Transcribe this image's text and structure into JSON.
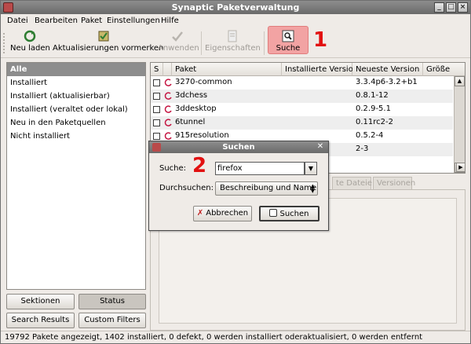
{
  "window": {
    "title": "Synaptic Paketverwaltung",
    "controls": [
      "_",
      "□",
      "×"
    ]
  },
  "menu": [
    "Datei",
    "Bearbeiten",
    "Paket",
    "Einstellungen",
    "Hilfe"
  ],
  "toolbar": {
    "reload": "Neu laden",
    "mark_upgrades": "Aktualisierungen vormerken",
    "apply": "Anwenden",
    "properties": "Eigenschaften",
    "search": "Suche"
  },
  "annotations": {
    "one": "1",
    "two": "2"
  },
  "filters": [
    "Alle",
    "Installiert",
    "Installiert (aktualisierbar)",
    "Installiert (veraltet oder lokal)",
    "Neu in den Paketquellen",
    "Nicht installiert"
  ],
  "left_buttons": {
    "sections": "Sektionen",
    "status": "Status",
    "search_results": "Search Results",
    "custom_filters": "Custom Filters"
  },
  "table": {
    "headers": {
      "s": "S",
      "package": "Paket",
      "installed": "Installierte Version",
      "latest": "Neueste Version",
      "size": "Größe"
    },
    "rows": [
      {
        "name": "3270-common",
        "latest": "3.3.4p6-3.2+b1"
      },
      {
        "name": "3dchess",
        "latest": "0.8.1-12"
      },
      {
        "name": "3ddesktop",
        "latest": "0.2.9-5.1"
      },
      {
        "name": "6tunnel",
        "latest": "0.11rc2-2"
      },
      {
        "name": "915resolution",
        "latest": "0.5.2-4"
      },
      {
        "name": "",
        "latest": "2-3"
      }
    ]
  },
  "tabs": {
    "files": "te Dateien",
    "versions": "Versionen"
  },
  "dialog": {
    "title": "Suchen",
    "search_label": "Suche:",
    "search_value": "firefox",
    "scope_label": "Durchsuchen:",
    "scope_value": "Beschreibung und Name",
    "cancel": "Abbrechen",
    "search_button": "Suchen"
  },
  "statusbar": "19792 Pakete angezeigt, 1402 installiert, 0 defekt, 0 werden installiert oderaktualisiert, 0 werden entfernt"
}
